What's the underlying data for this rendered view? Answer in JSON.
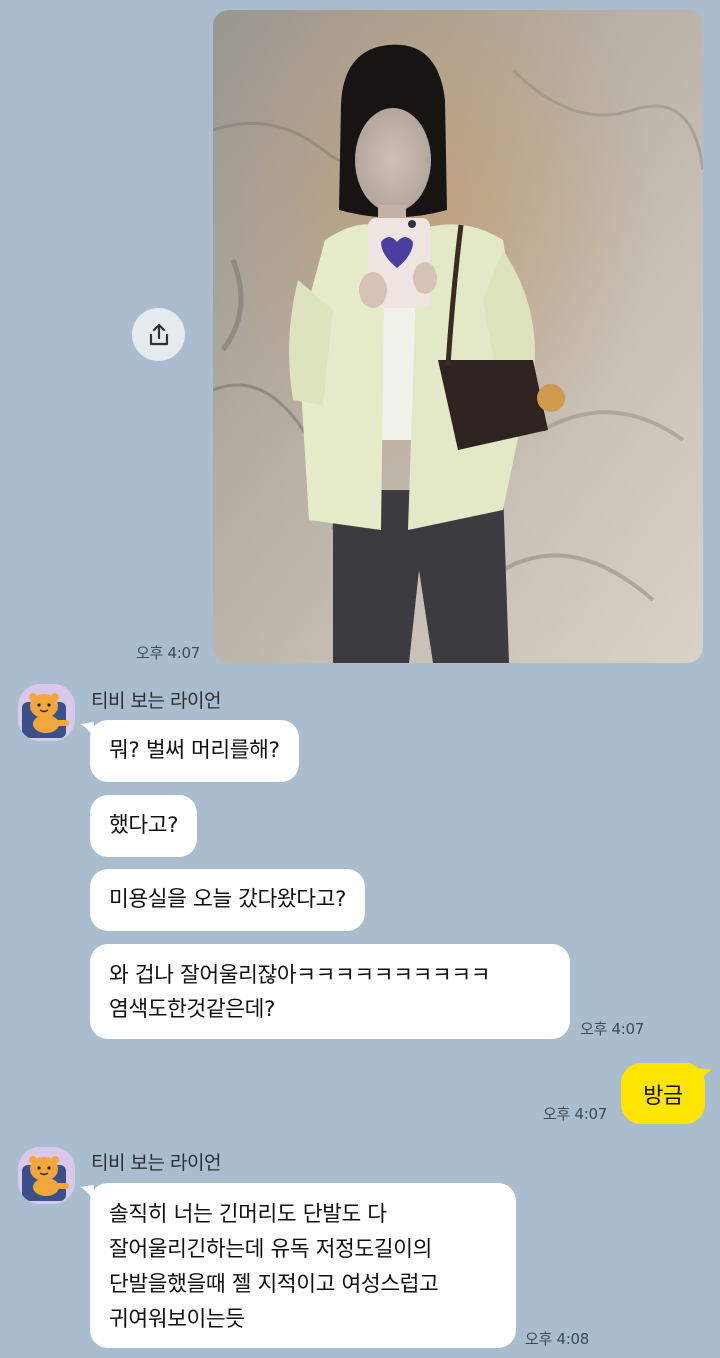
{
  "photo_message": {
    "time": "오후 4:07",
    "share_icon": "share-upload-icon"
  },
  "group1": {
    "sender": "티비 보는 라이언",
    "avatar_icon": "ryan-lion-avatar",
    "messages": [
      {
        "lines": [
          "뭐? 벌써 머리를해?"
        ]
      },
      {
        "lines": [
          "했다고?"
        ]
      },
      {
        "lines": [
          "미용실을 오늘 갔다왔다고?"
        ]
      },
      {
        "lines": [
          "와 겁나 잘어울리잖아ㅋㅋㅋㅋㅋㅋㅋㅋㅋㅋ",
          "염색도한것같은데?"
        ]
      }
    ],
    "time": "오후 4:07"
  },
  "my_message": {
    "text": "방금",
    "time": "오후 4:07",
    "color": "#fee500"
  },
  "group2": {
    "sender": "티비 보는 라이언",
    "avatar_icon": "ryan-lion-avatar",
    "messages": [
      {
        "lines": [
          "솔직히 너는 긴머리도 단발도 다",
          "잘어울리긴하는데 유독 저정도길이의",
          "단발을했을때 젤 지적이고 여성스럽고",
          "귀여워보이는듯"
        ]
      }
    ],
    "time": "오후 4:08"
  },
  "colors": {
    "background": "#a9bdce",
    "my_bubble": "#fee500",
    "their_bubble": "#ffffff"
  }
}
